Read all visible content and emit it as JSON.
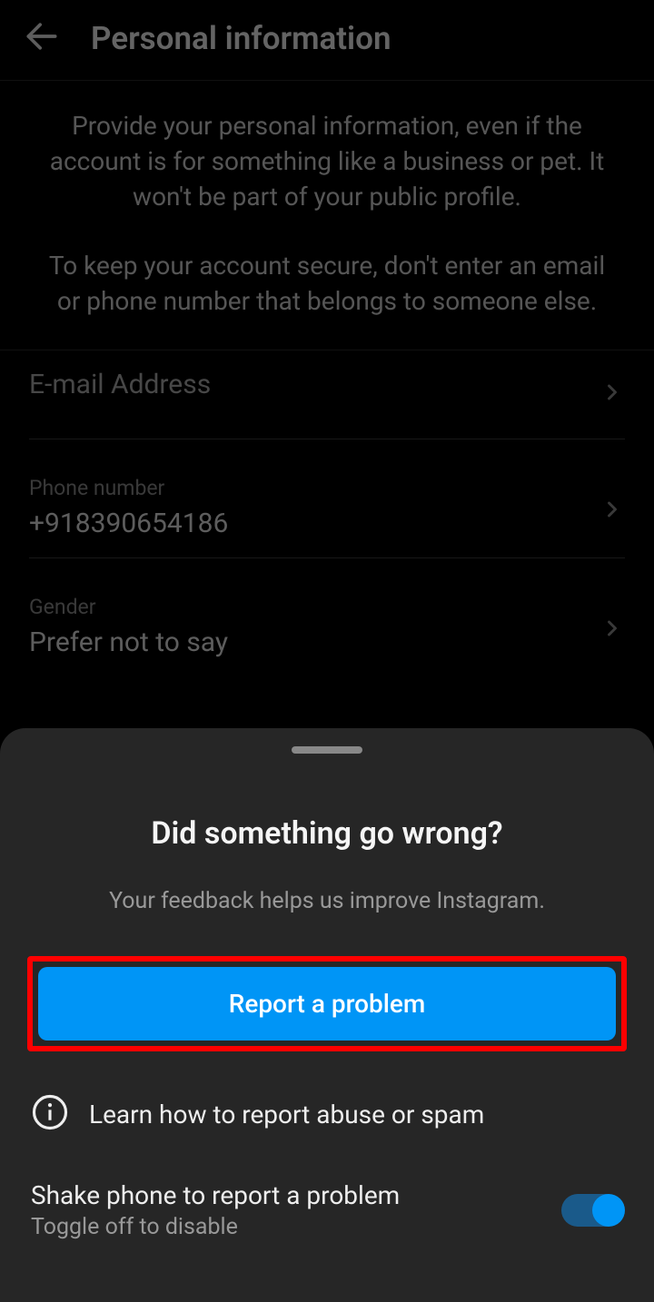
{
  "header": {
    "title": "Personal information"
  },
  "intro": {
    "p1": "Provide your personal information, even if the account is for something like a business or pet. It won't be part of your public profile.",
    "p2": "To keep your account secure, don't enter an email or phone number that belongs to someone else."
  },
  "fields": {
    "email": {
      "label": "E-mail Address",
      "value": ""
    },
    "phone": {
      "label": "Phone number",
      "value": "+918390654186"
    },
    "gender": {
      "label": "Gender",
      "value": "Prefer not to say"
    }
  },
  "sheet": {
    "title": "Did something go wrong?",
    "subtitle": "Your feedback helps us improve Instagram.",
    "report_btn": "Report a problem",
    "learn_link": "Learn how to report abuse or spam",
    "shake": {
      "title": "Shake phone to report a problem",
      "subtitle": "Toggle off to disable"
    }
  }
}
